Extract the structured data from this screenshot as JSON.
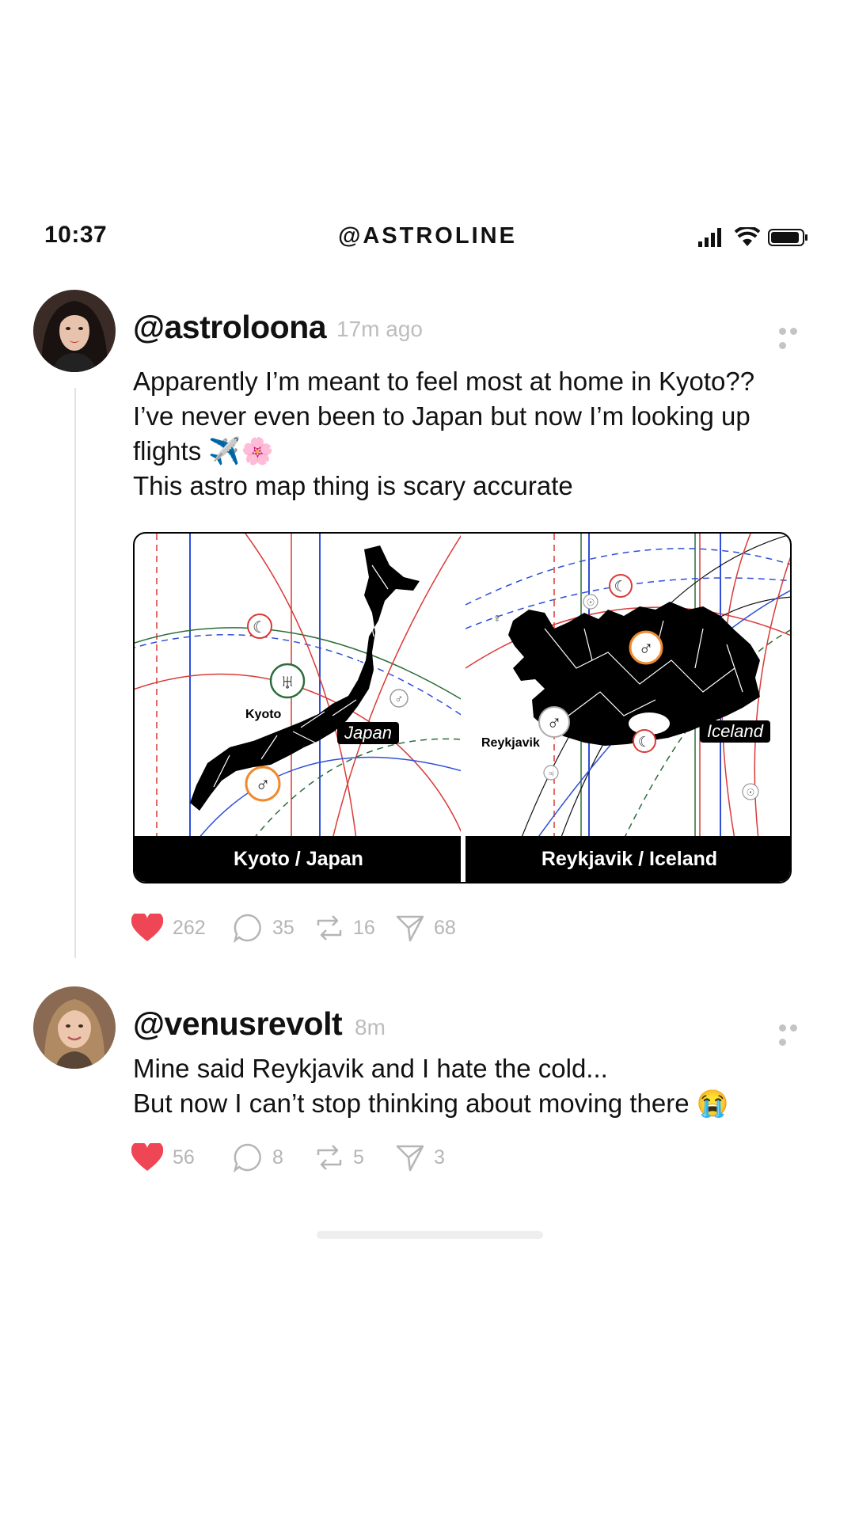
{
  "status": {
    "time": "10:37",
    "app_title": "@ASTROLINE"
  },
  "posts": [
    {
      "handle": "@astroloona",
      "time": "17m ago",
      "lines": [
        "Apparently I’m meant to feel most at home in Kyoto??",
        "I’ve never even been to Japan but now I’m looking up",
        "flights ✈️🌸",
        "This astro map thing is scary accurate"
      ],
      "media": {
        "left": {
          "caption": "Kyoto / Japan",
          "city_label": "Kyoto",
          "country_tag": "Japan"
        },
        "right": {
          "caption": "Reykjavik / Iceland",
          "city_label": "Reykjavik",
          "country_tag": "Iceland"
        }
      },
      "stats": {
        "likes": "262",
        "comments": "35",
        "reposts": "16",
        "shares": "68"
      }
    },
    {
      "handle": "@venusrevolt",
      "time": "8m",
      "lines": [
        "Mine said Reykjavik and I hate the cold...",
        "But now I can’t stop thinking about moving there 😭"
      ],
      "stats": {
        "likes": "56",
        "comments": "8",
        "reposts": "5",
        "shares": "3"
      }
    }
  ],
  "colors": {
    "heart": "#ef4655",
    "muted": "#b5b5b5",
    "line_red": "#d93a36",
    "line_blue": "#2f4fd8",
    "line_green": "#2b6d3a"
  },
  "icons": [
    "signal-icon",
    "wifi-icon",
    "battery-icon",
    "more-icon",
    "heart-icon",
    "comment-icon",
    "repost-icon",
    "share-icon"
  ]
}
